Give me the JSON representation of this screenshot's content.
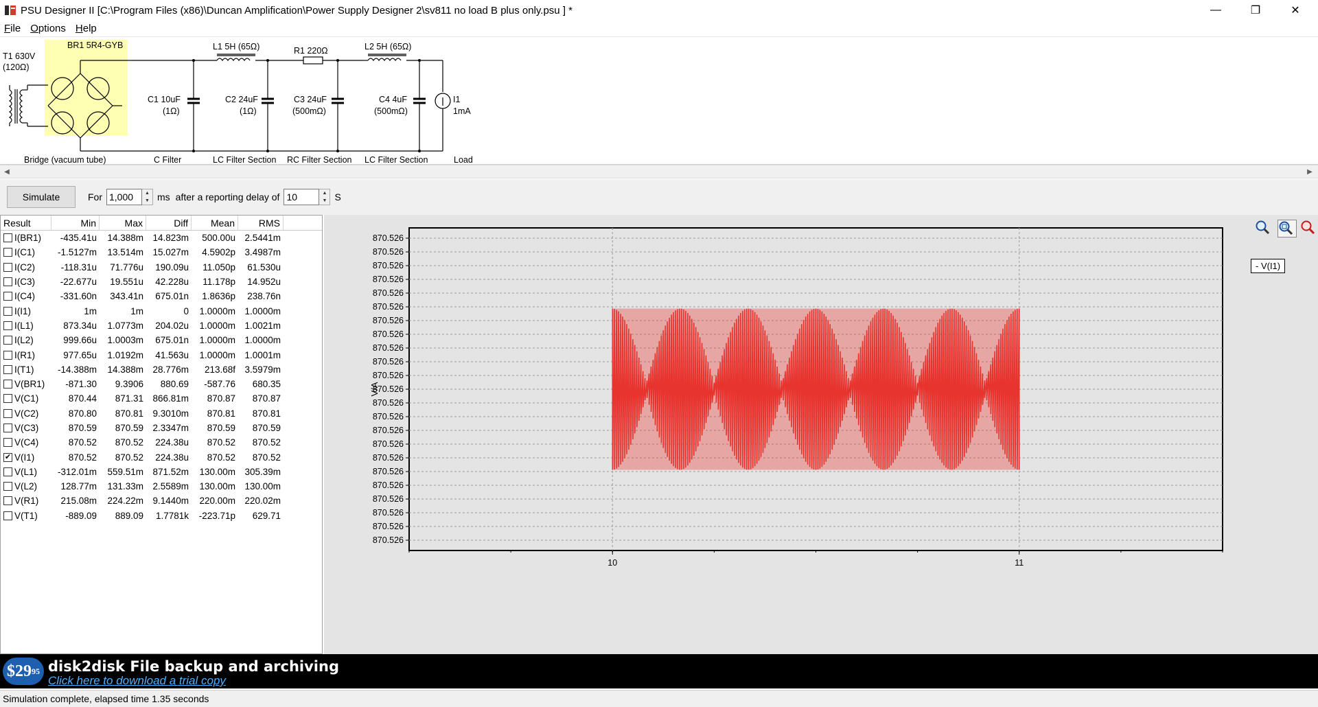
{
  "window": {
    "title": "PSU Designer II  [C:\\Program Files (x86)\\Duncan Amplification\\Power Supply Designer 2\\sv811 no load B plus only.psu ] *",
    "icon": "psu-app-icon",
    "min_glyph": "—",
    "max_glyph": "❐",
    "close_glyph": "✕"
  },
  "menu": [
    {
      "label": "File",
      "ul": "F",
      "rest": "ile"
    },
    {
      "label": "Options",
      "ul": "O",
      "rest": "ptions"
    },
    {
      "label": "Help",
      "ul": "H",
      "rest": "elp"
    }
  ],
  "schematic": {
    "t1": [
      "T1 630V",
      "(120Ω)"
    ],
    "br1": "BR1 5R4-GYB",
    "l1": "L1 5H (65Ω)",
    "r1": "R1 220Ω",
    "l2": "L2 5H (65Ω)",
    "c1": [
      "C1 10uF",
      "(1Ω)"
    ],
    "c2": [
      "C2 24uF",
      "(1Ω)"
    ],
    "c3": [
      "C3 24uF",
      "(500mΩ)"
    ],
    "c4": [
      "C4 4uF",
      "(500mΩ)"
    ],
    "i1": [
      "I1",
      "1mA"
    ],
    "sections": [
      "Bridge (vacuum tube)",
      "C Filter",
      "LC Filter Section",
      "RC Filter Section",
      "LC Filter Section",
      "Load"
    ]
  },
  "controls": {
    "simulate": "Simulate",
    "for_label": "For",
    "duration": "1,000",
    "ms_label": "ms",
    "delay_label": "after a reporting delay of",
    "delay": "10",
    "s_label": "S"
  },
  "results": {
    "headers": [
      "Result",
      "Min",
      "Max",
      "Diff",
      "Mean",
      "RMS"
    ],
    "rows": [
      {
        "name": "I(BR1)",
        "min": "-435.41u",
        "max": "14.388m",
        "diff": "14.823m",
        "mean": "500.00u",
        "rms": "2.5441m",
        "checked": false
      },
      {
        "name": "I(C1)",
        "min": "-1.5127m",
        "max": "13.514m",
        "diff": "15.027m",
        "mean": "4.5902p",
        "rms": "3.4987m",
        "checked": false
      },
      {
        "name": "I(C2)",
        "min": "-118.31u",
        "max": "71.776u",
        "diff": "190.09u",
        "mean": "11.050p",
        "rms": "61.530u",
        "checked": false
      },
      {
        "name": "I(C3)",
        "min": "-22.677u",
        "max": "19.551u",
        "diff": "42.228u",
        "mean": "11.178p",
        "rms": "14.952u",
        "checked": false
      },
      {
        "name": "I(C4)",
        "min": "-331.60n",
        "max": "343.41n",
        "diff": "675.01n",
        "mean": "1.8636p",
        "rms": "238.76n",
        "checked": false
      },
      {
        "name": "I(I1)",
        "min": "1m",
        "max": "1m",
        "diff": "0",
        "mean": "1.0000m",
        "rms": "1.0000m",
        "checked": false
      },
      {
        "name": "I(L1)",
        "min": "873.34u",
        "max": "1.0773m",
        "diff": "204.02u",
        "mean": "1.0000m",
        "rms": "1.0021m",
        "checked": false
      },
      {
        "name": "I(L2)",
        "min": "999.66u",
        "max": "1.0003m",
        "diff": "675.01n",
        "mean": "1.0000m",
        "rms": "1.0000m",
        "checked": false
      },
      {
        "name": "I(R1)",
        "min": "977.65u",
        "max": "1.0192m",
        "diff": "41.563u",
        "mean": "1.0000m",
        "rms": "1.0001m",
        "checked": false
      },
      {
        "name": "I(T1)",
        "min": "-14.388m",
        "max": "14.388m",
        "diff": "28.776m",
        "mean": "213.68f",
        "rms": "3.5979m",
        "checked": false
      },
      {
        "name": "V(BR1)",
        "min": "-871.30",
        "max": "9.3906",
        "diff": "880.69",
        "mean": "-587.76",
        "rms": "680.35",
        "checked": false
      },
      {
        "name": "V(C1)",
        "min": "870.44",
        "max": "871.31",
        "diff": "866.81m",
        "mean": "870.87",
        "rms": "870.87",
        "checked": false
      },
      {
        "name": "V(C2)",
        "min": "870.80",
        "max": "870.81",
        "diff": "9.3010m",
        "mean": "870.81",
        "rms": "870.81",
        "checked": false
      },
      {
        "name": "V(C3)",
        "min": "870.59",
        "max": "870.59",
        "diff": "2.3347m",
        "mean": "870.59",
        "rms": "870.59",
        "checked": false
      },
      {
        "name": "V(C4)",
        "min": "870.52",
        "max": "870.52",
        "diff": "224.38u",
        "mean": "870.52",
        "rms": "870.52",
        "checked": false
      },
      {
        "name": "V(I1)",
        "min": "870.52",
        "max": "870.52",
        "diff": "224.38u",
        "mean": "870.52",
        "rms": "870.52",
        "checked": true
      },
      {
        "name": "V(L1)",
        "min": "-312.01m",
        "max": "559.51m",
        "diff": "871.52m",
        "mean": "130.00m",
        "rms": "305.39m",
        "checked": false
      },
      {
        "name": "V(L2)",
        "min": "128.77m",
        "max": "131.33m",
        "diff": "2.5589m",
        "mean": "130.00m",
        "rms": "130.00m",
        "checked": false
      },
      {
        "name": "V(R1)",
        "min": "215.08m",
        "max": "224.22m",
        "diff": "9.1440m",
        "mean": "220.00m",
        "rms": "220.02m",
        "checked": false
      },
      {
        "name": "V(T1)",
        "min": "-889.09",
        "max": "889.09",
        "diff": "1.7781k",
        "mean": "-223.71p",
        "rms": "629.71",
        "checked": false
      }
    ]
  },
  "graph": {
    "legend": "- V(I1)",
    "tools": [
      "zoom-in-icon",
      "zoom-fit-icon",
      "zoom-out-icon"
    ]
  },
  "chart_data": {
    "type": "line",
    "ylabel": "V/A",
    "xlabel": "",
    "x_ticks": [
      "10",
      "11"
    ],
    "xlim": [
      9.5,
      11.5
    ],
    "y_ticks": [
      "870.526",
      "870.526",
      "870.526",
      "870.526",
      "870.526",
      "870.526",
      "870.526",
      "870.526",
      "870.526",
      "870.526",
      "870.526",
      "870.526",
      "870.526",
      "870.526",
      "870.526",
      "870.526",
      "870.526",
      "870.526",
      "870.526",
      "870.526",
      "870.526",
      "870.526",
      "870.526"
    ],
    "grid": true,
    "series": [
      {
        "name": "V(I1)",
        "color": "#e8342f",
        "x_range": [
          10,
          11
        ],
        "mean": 870.52,
        "ripple_pp": "224.38u",
        "ripple_pp_rel": 0.5
      }
    ]
  },
  "ad": {
    "price": "$29",
    "price_cents": "95",
    "title": "disk2disk File backup and archiving",
    "link": "Click here to download a trial copy"
  },
  "status": "Simulation complete, elapsed time 1.35 seconds"
}
